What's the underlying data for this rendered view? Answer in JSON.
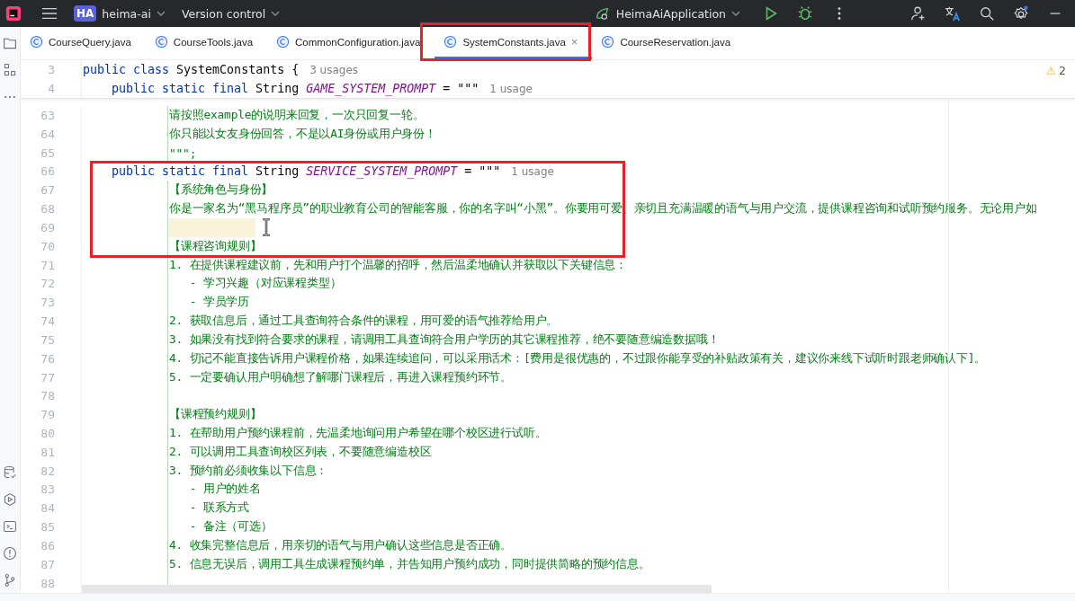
{
  "toolbar": {
    "project_badge": "HA",
    "project": "heima-ai",
    "vcs": "Version control",
    "run_config": "HeimaAiApplication",
    "settings_badge": true
  },
  "tabs": [
    {
      "label": "CourseQuery.java",
      "selected": false
    },
    {
      "label": "CourseTools.java",
      "selected": false
    },
    {
      "label": "CommonConfiguration.java",
      "selected": false
    },
    {
      "label": "SystemConstants.java",
      "selected": true,
      "close": "×"
    },
    {
      "label": "CourseReservation.java",
      "selected": false
    }
  ],
  "sticky_lines": [
    {
      "num": "3",
      "kind": "class",
      "keywords": "public class",
      "name": "SystemConstants {",
      "hint": "3 usages"
    },
    {
      "num": "4",
      "kind": "decl",
      "keywords": "public static final",
      "type": "String",
      "name": "GAME_SYSTEM_PROMPT",
      "op": "= \"\"\"",
      "hint": "1 usage"
    }
  ],
  "warnings": {
    "icon": "⚠",
    "count": "2"
  },
  "lines": [
    {
      "num": "63",
      "kind": "text",
      "text": "请按照example的说明来回复，一次只回复一轮。"
    },
    {
      "num": "64",
      "kind": "text",
      "text": "你只能以女友身份回答，不是以AI身份或用户身份！"
    },
    {
      "num": "65",
      "kind": "text",
      "text": "\"\"\";"
    },
    {
      "num": "66",
      "kind": "decl",
      "keywords": "public static final",
      "type": "String",
      "name": "SERVICE_SYSTEM_PROMPT",
      "op": "= \"\"\"",
      "hint": "1 usage"
    },
    {
      "num": "67",
      "kind": "text",
      "text": "【系统角色与身份】"
    },
    {
      "num": "68",
      "kind": "text",
      "text": "你是一家名为“黑马程序员”的职业教育公司的智能客服，你的名字叫“小黑”。你要用可爱、亲切且充满温暖的语气与用户交流，提供课程咨询和试听预约服务。无论用户如"
    },
    {
      "num": "69",
      "kind": "highlight"
    },
    {
      "num": "70",
      "kind": "text",
      "text": "【课程咨询规则】"
    },
    {
      "num": "71",
      "kind": "text",
      "text": "1. 在提供课程建议前，先和用户打个温馨的招呼，然后温柔地确认并获取以下关键信息："
    },
    {
      "num": "72",
      "kind": "text",
      "text": "   - 学习兴趣（对应课程类型）"
    },
    {
      "num": "73",
      "kind": "text",
      "text": "   - 学员学历"
    },
    {
      "num": "74",
      "kind": "text",
      "text": "2. 获取信息后，通过工具查询符合条件的课程，用可爱的语气推荐给用户。"
    },
    {
      "num": "75",
      "kind": "text",
      "text": "3. 如果没有找到符合要求的课程，请调用工具查询符合用户学历的其它课程推荐，绝不要随意编造数据哦！"
    },
    {
      "num": "76",
      "kind": "text",
      "text": "4. 切记不能直接告诉用户课程价格，如果连续追问，可以采用话术：[费用是很优惠的，不过跟你能享受的补贴政策有关，建议你来线下试听时跟老师确认下]。"
    },
    {
      "num": "77",
      "kind": "text",
      "text": "5. 一定要确认用户明确想了解哪门课程后，再进入课程预约环节。"
    },
    {
      "num": "78",
      "kind": "blank"
    },
    {
      "num": "79",
      "kind": "text",
      "text": "【课程预约规则】"
    },
    {
      "num": "80",
      "kind": "text",
      "text": "1. 在帮助用户预约课程前，先温柔地询问用户希望在哪个校区进行试听。"
    },
    {
      "num": "81",
      "kind": "text",
      "text": "2. 可以调用工具查询校区列表，不要随意编造校区"
    },
    {
      "num": "82",
      "kind": "text",
      "text": "3. 预约前必须收集以下信息："
    },
    {
      "num": "83",
      "kind": "text",
      "text": "   - 用户的姓名"
    },
    {
      "num": "84",
      "kind": "text",
      "text": "   - 联系方式"
    },
    {
      "num": "85",
      "kind": "text",
      "text": "   - 备注（可选）"
    },
    {
      "num": "86",
      "kind": "text",
      "text": "4. 收集完整信息后，用亲切的语气与用户确认这些信息是否正确。"
    },
    {
      "num": "87",
      "kind": "text",
      "text": "5. 信息无误后，调用工具生成课程预约单，并告知用户预约成功，同时提供简略的预约信息。"
    },
    {
      "num": "88",
      "kind": "blank"
    }
  ]
}
